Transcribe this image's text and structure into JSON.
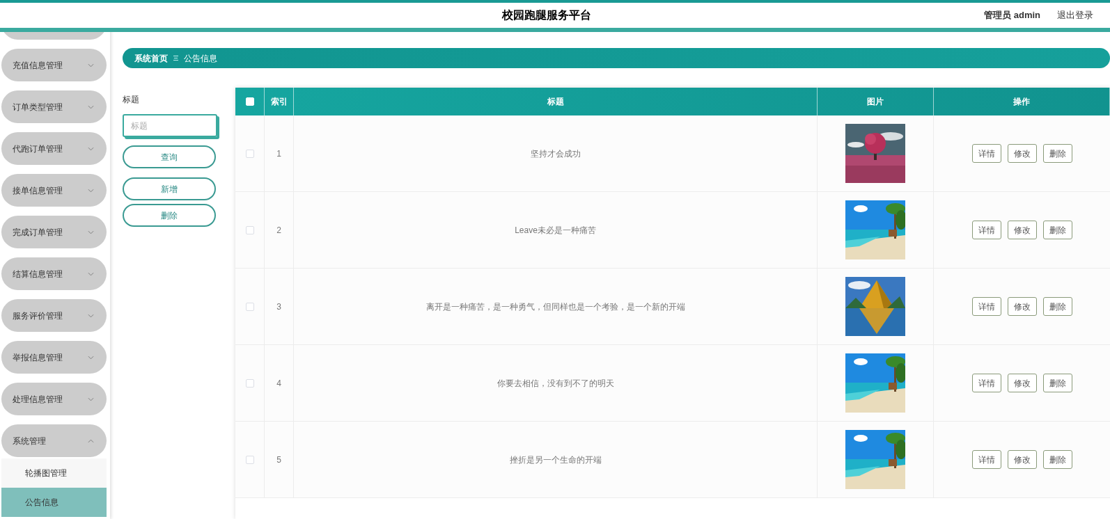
{
  "header": {
    "title": "校园跑腿服务平台",
    "user": "管理员 admin",
    "logout": "退出登录"
  },
  "sidebar": {
    "items": [
      {
        "label": "充值信息管理",
        "expanded": false
      },
      {
        "label": "订单类型管理",
        "expanded": false
      },
      {
        "label": "代跑订单管理",
        "expanded": false
      },
      {
        "label": "接单信息管理",
        "expanded": false
      },
      {
        "label": "完成订单管理",
        "expanded": false
      },
      {
        "label": "结算信息管理",
        "expanded": false
      },
      {
        "label": "服务评价管理",
        "expanded": false
      },
      {
        "label": "举报信息管理",
        "expanded": false
      },
      {
        "label": "处理信息管理",
        "expanded": false
      },
      {
        "label": "系统管理",
        "expanded": true,
        "children": [
          {
            "label": "轮播图管理",
            "selected": false
          },
          {
            "label": "公告信息",
            "selected": true
          }
        ]
      }
    ]
  },
  "breadcrumb": {
    "home": "系统首页",
    "current": "公告信息"
  },
  "search": {
    "label": "标题",
    "placeholder": "标题",
    "buttons": [
      "查询",
      "新增",
      "删除"
    ]
  },
  "table": {
    "columns": [
      "索引",
      "标题",
      "图片",
      "操作"
    ],
    "header_checked": false,
    "rows": [
      {
        "index": "1",
        "title": "坚持才会成功",
        "checked": false,
        "picture": {
          "kind": "picture"
        },
        "actions": [
          "详情",
          "修改",
          "删除"
        ]
      },
      {
        "index": "2",
        "title": "Leave未必是一种痛苦",
        "checked": false,
        "picture": {
          "kind": "picture"
        },
        "actions": [
          "详情",
          "修改",
          "删除"
        ]
      },
      {
        "index": "3",
        "title": "离开是一种痛苦，是一种勇气，但同样也是一个考验，是一个新的开端",
        "checked": false,
        "picture": {
          "kind": "picture"
        },
        "actions": [
          "详情",
          "修改",
          "删除"
        ]
      },
      {
        "index": "4",
        "title": "你要去相信，没有到不了的明天",
        "checked": false,
        "picture": {
          "kind": "picture"
        },
        "actions": [
          "详情",
          "修改",
          "删除"
        ]
      },
      {
        "index": "5",
        "title": "挫折是另一个生命的开端",
        "checked": false,
        "picture": {
          "kind": "picture"
        },
        "actions": [
          "详情",
          "修改",
          "删除"
        ]
      }
    ]
  }
}
